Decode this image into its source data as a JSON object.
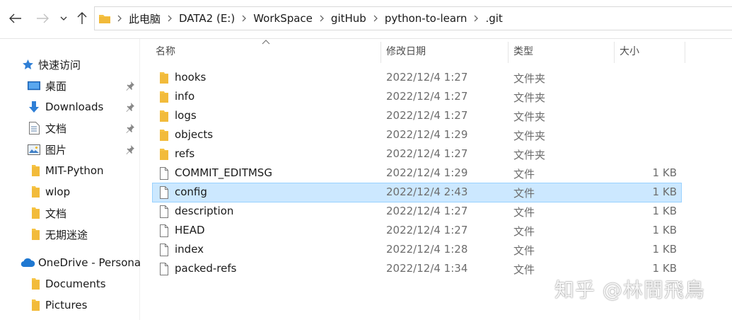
{
  "address": {
    "crumbs": [
      "此电脑",
      "DATA2 (E:)",
      "WorkSpace",
      "gitHub",
      "python-to-learn",
      ".git"
    ]
  },
  "sidebar": {
    "quick_access": "快速访问",
    "items": [
      {
        "label": "桌面",
        "icon": "desktop-icon",
        "pinned": true
      },
      {
        "label": "Downloads",
        "icon": "download-icon",
        "pinned": true
      },
      {
        "label": "文档",
        "icon": "document-icon",
        "pinned": true
      },
      {
        "label": "图片",
        "icon": "picture-icon",
        "pinned": true
      },
      {
        "label": "MIT-Python",
        "icon": "folder-icon",
        "pinned": false
      },
      {
        "label": "wlop",
        "icon": "folder-icon",
        "pinned": false
      },
      {
        "label": "文档",
        "icon": "folder-icon",
        "pinned": false
      },
      {
        "label": "无期迷途",
        "icon": "folder-icon",
        "pinned": false
      }
    ],
    "onedrive": "OneDrive - Persona",
    "onedrive_items": [
      {
        "label": "Documents",
        "icon": "folder-icon"
      },
      {
        "label": "Pictures",
        "icon": "folder-icon"
      }
    ]
  },
  "columns": {
    "name": "名称",
    "modified": "修改日期",
    "type": "类型",
    "size": "大小"
  },
  "files": [
    {
      "name": "hooks",
      "modified": "2022/12/4 1:27",
      "type": "文件夹",
      "size": "",
      "kind": "folder"
    },
    {
      "name": "info",
      "modified": "2022/12/4 1:27",
      "type": "文件夹",
      "size": "",
      "kind": "folder"
    },
    {
      "name": "logs",
      "modified": "2022/12/4 1:27",
      "type": "文件夹",
      "size": "",
      "kind": "folder"
    },
    {
      "name": "objects",
      "modified": "2022/12/4 1:29",
      "type": "文件夹",
      "size": "",
      "kind": "folder"
    },
    {
      "name": "refs",
      "modified": "2022/12/4 1:27",
      "type": "文件夹",
      "size": "",
      "kind": "folder"
    },
    {
      "name": "COMMIT_EDITMSG",
      "modified": "2022/12/4 1:29",
      "type": "文件",
      "size": "1 KB",
      "kind": "file"
    },
    {
      "name": "config",
      "modified": "2022/12/4 2:43",
      "type": "文件",
      "size": "1 KB",
      "kind": "file",
      "selected": true
    },
    {
      "name": "description",
      "modified": "2022/12/4 1:27",
      "type": "文件",
      "size": "1 KB",
      "kind": "file"
    },
    {
      "name": "HEAD",
      "modified": "2022/12/4 1:27",
      "type": "文件",
      "size": "1 KB",
      "kind": "file"
    },
    {
      "name": "index",
      "modified": "2022/12/4 1:28",
      "type": "文件",
      "size": "1 KB",
      "kind": "file"
    },
    {
      "name": "packed-refs",
      "modified": "2022/12/4 1:34",
      "type": "文件",
      "size": "1 KB",
      "kind": "file"
    }
  ],
  "watermark": "知乎 @林間飛鳥",
  "colors": {
    "folder": "#f6c343",
    "folder_dark": "#e8a82a",
    "selection": "#cce8ff",
    "selection_border": "#99d1ff",
    "accent": "#0078d4"
  }
}
